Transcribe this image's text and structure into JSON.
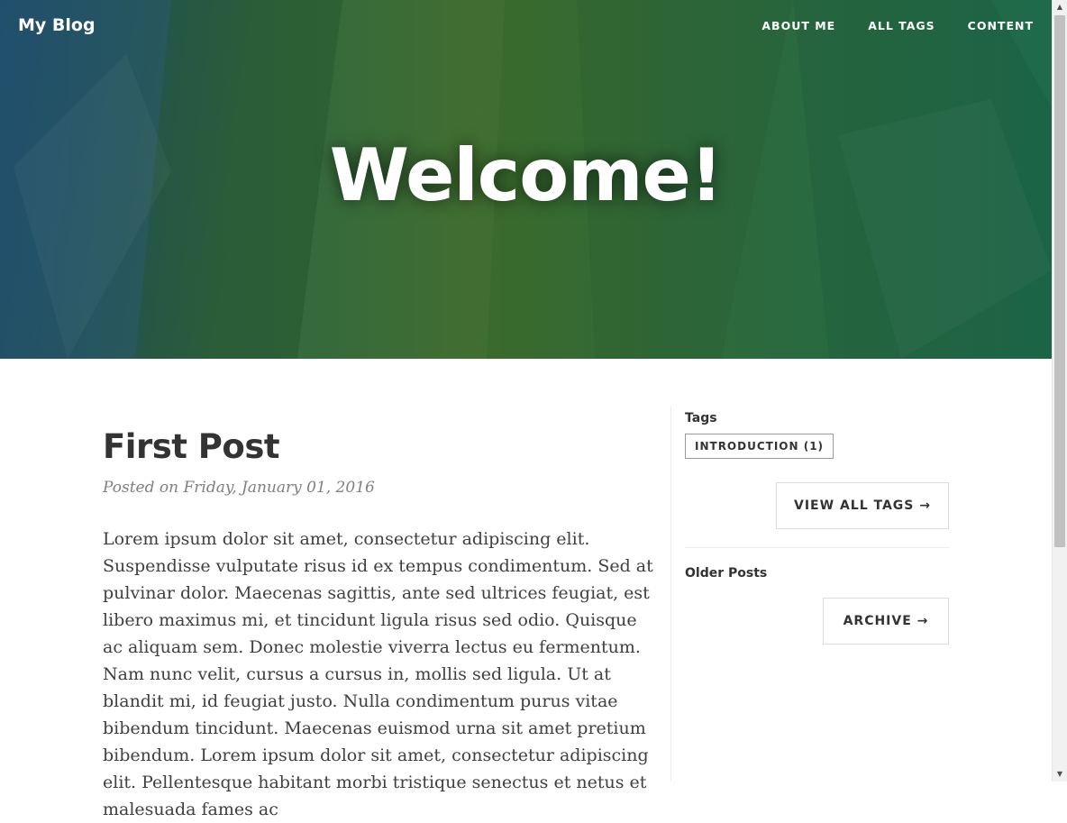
{
  "header": {
    "brand": "My Blog",
    "nav": [
      "ABOUT ME",
      "ALL TAGS",
      "CONTENT"
    ],
    "title": "Welcome!"
  },
  "post": {
    "title": "First Post",
    "meta": "Posted on Friday, January 01, 2016",
    "body": "Lorem ipsum dolor sit amet, consectetur adipiscing elit. Suspendisse vulputate risus id ex tempus condimentum. Sed at pulvinar dolor. Maecenas sagittis, ante sed ultrices feugiat, est libero maximus mi, et tincidunt ligula risus sed odio. Quisque ac aliquam sem. Donec molestie viverra lectus eu fermentum. Nam nunc velit, cursus a cursus in, mollis sed ligula. Ut at blandit mi, id feugiat justo. Nulla condimentum purus vitae bibendum tincidunt. Maecenas euismod urna sit amet pretium bibendum. Lorem ipsum dolor sit amet, consectetur adipiscing elit. Pellentesque habitant morbi tristique senectus et netus et malesuada fames ac"
  },
  "sidebar": {
    "tags_heading": "Tags",
    "tags": [
      "INTRODUCTION (1)"
    ],
    "view_all_tags": "VIEW ALL TAGS →",
    "older_heading": "Older Posts",
    "archive": "ARCHIVE →"
  },
  "colors": {
    "hero_green": "#3b6a2a",
    "hero_teal": "#1e6a4a",
    "text": "#404040"
  }
}
